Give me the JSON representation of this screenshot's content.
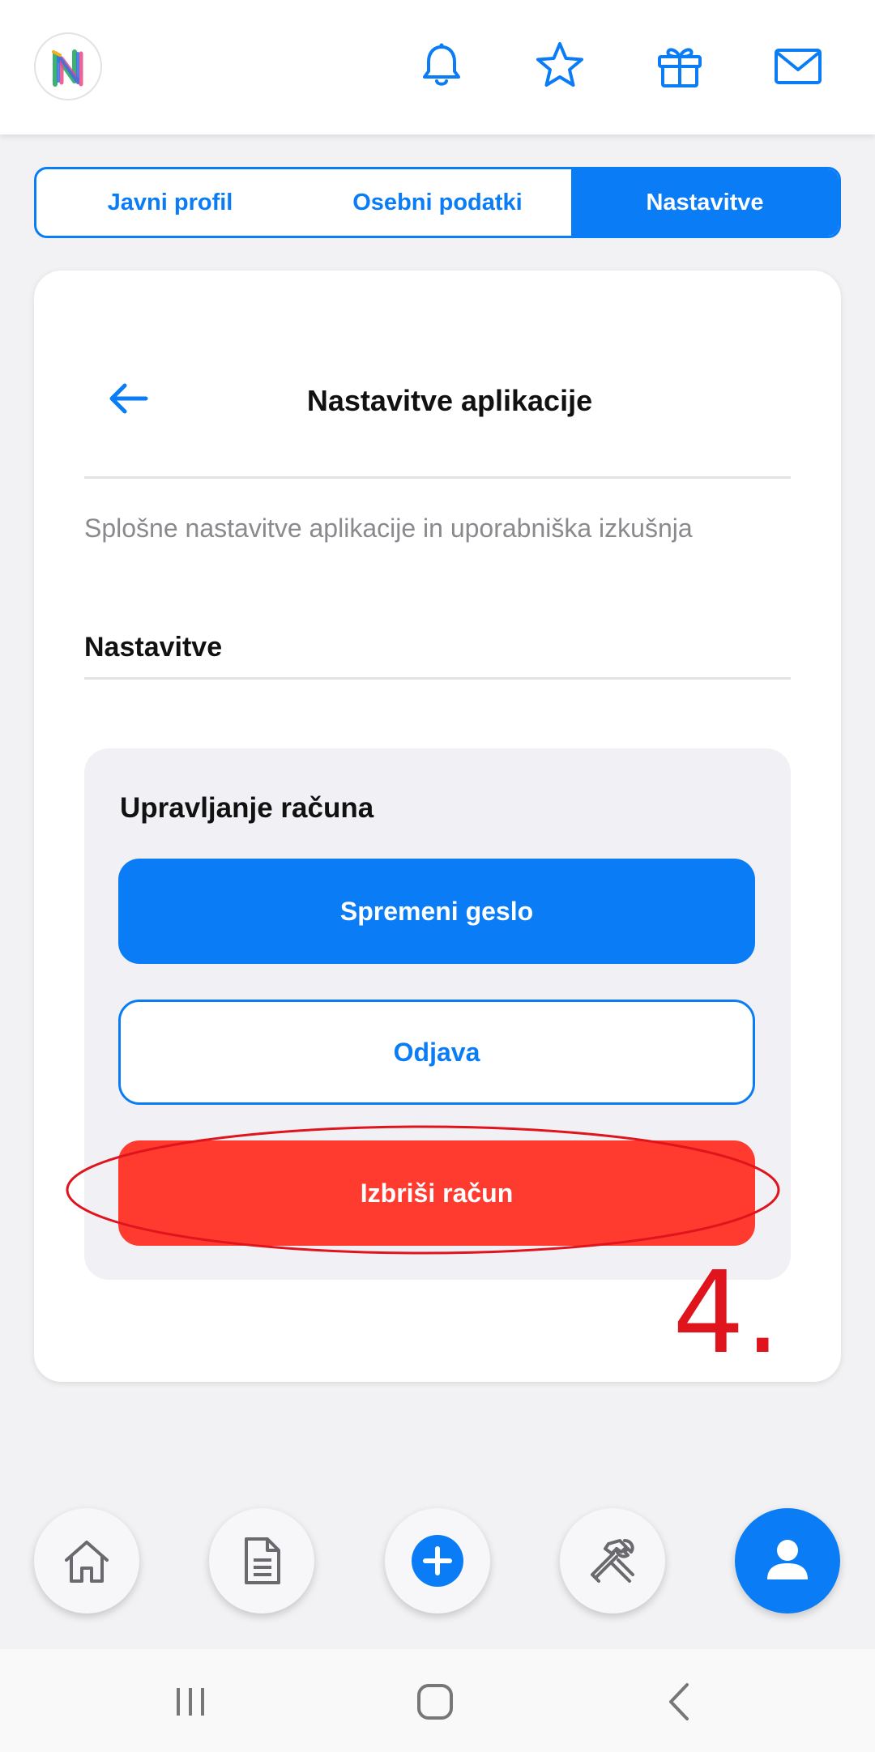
{
  "header": {
    "logo_icon": "app-logo-n",
    "icons": [
      "bell-icon",
      "star-icon",
      "gift-icon",
      "mail-icon"
    ]
  },
  "tabs": [
    {
      "label": "Javni profil",
      "active": false
    },
    {
      "label": "Osebni podatki",
      "active": false
    },
    {
      "label": "Nastavitve",
      "active": true
    }
  ],
  "card": {
    "title": "Nastavitve aplikacije",
    "subtitle": "Splošne nastavitve aplikacije in uporabniška izkušnja",
    "section_label": "Nastavitve",
    "panel": {
      "title": "Upravljanje računa",
      "change_password": "Spremeni geslo",
      "logout": "Odjava",
      "delete_account": "Izbriši račun"
    }
  },
  "annotation": {
    "step": "4."
  },
  "bottom_nav": [
    "home-icon",
    "document-icon",
    "add-icon",
    "tools-icon",
    "profile-icon"
  ],
  "colors": {
    "accent": "#0a7cf6",
    "danger": "#ff3b30",
    "annotation": "#e0141c"
  }
}
